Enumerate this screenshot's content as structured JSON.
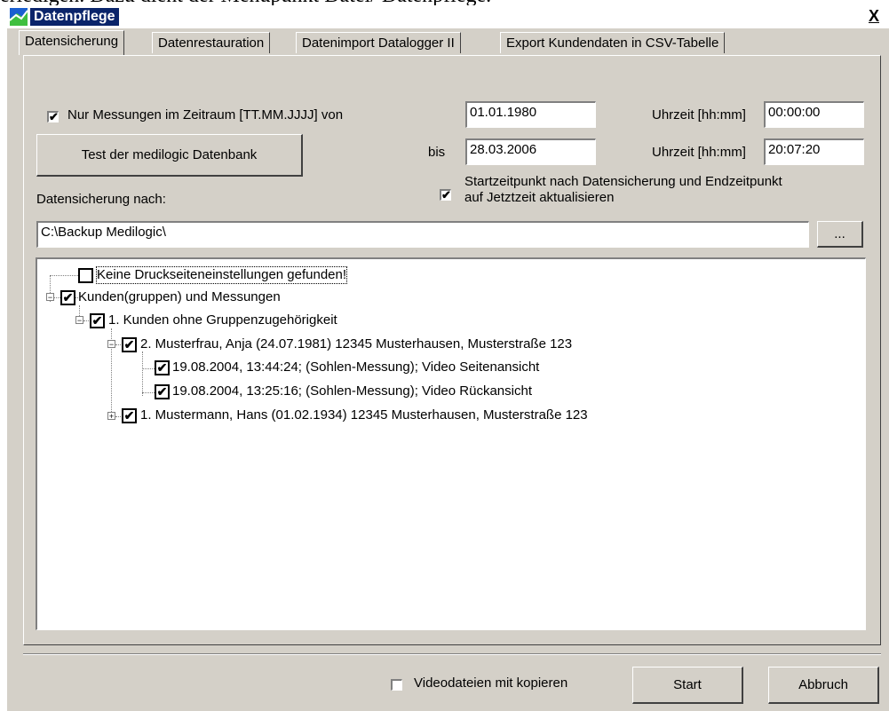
{
  "background_text": "erledigen. Dazu dient der Menüpunkt Datei/ Datenpflege.",
  "window": {
    "title": "Datenpflege",
    "close_label": "X"
  },
  "tabs": [
    {
      "label": "Datensicherung"
    },
    {
      "label": "Datenrestauration"
    },
    {
      "label": "Datenimport Datalogger II"
    },
    {
      "label": "Export Kundendaten in CSV-Tabelle"
    }
  ],
  "period": {
    "checkbox_label": "Nur Messungen im Zeitraum [TT.MM.JJJJ] von",
    "checked": "✔",
    "from_date": "01.01.1980",
    "to_label": "bis",
    "to_date": "28.03.2006",
    "time_label": "Uhrzeit [hh:mm]",
    "from_time": "00:00:00",
    "to_time": "20:07:20"
  },
  "test_button": "Test der medilogic Datenbank",
  "update_checkbox": {
    "label_line1": "Startzeitpunkt nach Datensicherung und Endzeitpunkt",
    "label_line2": "auf Jetztzeit aktualisieren",
    "checked": "✔"
  },
  "backup_path": {
    "label": "Datensicherung nach:",
    "value": "C:\\Backup Medilogic\\",
    "browse_label": "..."
  },
  "tree": [
    {
      "label": "Keine Druckseiteneinstellungen gefunden!",
      "checked": ""
    },
    {
      "label": "Kunden(gruppen) und Messungen",
      "checked": "✔",
      "expander": "−"
    },
    {
      "label": "1. Kunden ohne Gruppenzugehörigkeit",
      "checked": "✔",
      "expander": "−"
    },
    {
      "label": "2. Musterfrau, Anja (24.07.1981) 12345 Musterhausen, Musterstraße 123",
      "checked": "✔",
      "expander": "−"
    },
    {
      "label": "19.08.2004, 13:44:24; (Sohlen-Messung); Video Seitenansicht",
      "checked": "✔"
    },
    {
      "label": "19.08.2004, 13:25:16; (Sohlen-Messung); Video Rückansicht",
      "checked": "✔"
    },
    {
      "label": "1. Mustermann, Hans (01.02.1934) 12345 Musterhausen, Musterstraße 123",
      "checked": "✔",
      "expander": "+"
    }
  ],
  "footer": {
    "video_checkbox_label": "Videodateien mit kopieren",
    "video_checked": "",
    "start_label": "Start",
    "cancel_label": "Abbruch"
  },
  "colors": {
    "title_highlight": "#0a246a",
    "dialog_bg": "#d4d0c8"
  }
}
